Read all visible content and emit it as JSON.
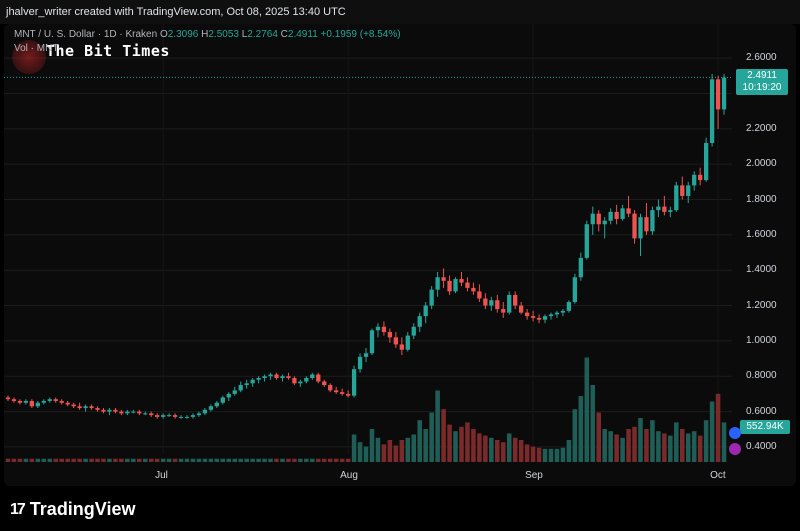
{
  "header": {
    "attribution": "jhalver_writer created with TradingView.com, Oct 08, 2025 13:40 UTC"
  },
  "legend": {
    "symbol": "MNT / U. S. Dollar · 1D · Kraken",
    "o_label": "O",
    "o_value": "2.3096",
    "h_label": "H",
    "h_value": "2.5053",
    "l_label": "L",
    "l_value": "2.2764",
    "c_label": "C",
    "c_value": "2.4911",
    "change": "+0.1959 (+8.54%)",
    "vol_label": "Vol · MNT"
  },
  "watermark": {
    "text": "The Bit Times"
  },
  "price_tag": {
    "price": "2.4911",
    "countdown": "10:19:20"
  },
  "volume_tag": {
    "value": "552.94K"
  },
  "footer": {
    "brand": "TradingView"
  },
  "colors": {
    "up": "#26a69a",
    "down": "#ef5350",
    "vol_up": "#1f5e57",
    "vol_down": "#7a2a2a",
    "background": "#0b0b0b"
  },
  "chart_data": {
    "type": "candlestick",
    "y_axis": {
      "ticks": [
        "2.6000",
        "2.4000",
        "2.2000",
        "2.0000",
        "1.8000",
        "1.6000",
        "1.4000",
        "1.2000",
        "1.0000",
        "0.8000",
        "0.6000",
        "0.4000"
      ],
      "ylim": [
        0.36,
        2.68
      ]
    },
    "x_axis": {
      "ticks": [
        "Jul",
        "Aug",
        "Sep",
        "Oct"
      ]
    },
    "last_price": 2.4911,
    "candles": [
      {
        "o": 0.68,
        "h": 0.69,
        "l": 0.66,
        "c": 0.67,
        "v": 0.03
      },
      {
        "o": 0.67,
        "h": 0.68,
        "l": 0.65,
        "c": 0.66,
        "v": 0.03
      },
      {
        "o": 0.66,
        "h": 0.67,
        "l": 0.64,
        "c": 0.65,
        "v": 0.03
      },
      {
        "o": 0.65,
        "h": 0.67,
        "l": 0.64,
        "c": 0.66,
        "v": 0.03
      },
      {
        "o": 0.66,
        "h": 0.67,
        "l": 0.62,
        "c": 0.63,
        "v": 0.03
      },
      {
        "o": 0.63,
        "h": 0.66,
        "l": 0.62,
        "c": 0.65,
        "v": 0.03
      },
      {
        "o": 0.65,
        "h": 0.67,
        "l": 0.64,
        "c": 0.66,
        "v": 0.03
      },
      {
        "o": 0.66,
        "h": 0.68,
        "l": 0.65,
        "c": 0.67,
        "v": 0.03
      },
      {
        "o": 0.67,
        "h": 0.68,
        "l": 0.65,
        "c": 0.66,
        "v": 0.03
      },
      {
        "o": 0.66,
        "h": 0.67,
        "l": 0.64,
        "c": 0.65,
        "v": 0.03
      },
      {
        "o": 0.65,
        "h": 0.66,
        "l": 0.63,
        "c": 0.64,
        "v": 0.03
      },
      {
        "o": 0.64,
        "h": 0.65,
        "l": 0.62,
        "c": 0.63,
        "v": 0.03
      },
      {
        "o": 0.63,
        "h": 0.65,
        "l": 0.61,
        "c": 0.62,
        "v": 0.03
      },
      {
        "o": 0.62,
        "h": 0.64,
        "l": 0.6,
        "c": 0.63,
        "v": 0.03
      },
      {
        "o": 0.63,
        "h": 0.64,
        "l": 0.61,
        "c": 0.62,
        "v": 0.03
      },
      {
        "o": 0.62,
        "h": 0.63,
        "l": 0.6,
        "c": 0.61,
        "v": 0.03
      },
      {
        "o": 0.61,
        "h": 0.62,
        "l": 0.59,
        "c": 0.6,
        "v": 0.03
      },
      {
        "o": 0.6,
        "h": 0.62,
        "l": 0.58,
        "c": 0.61,
        "v": 0.03
      },
      {
        "o": 0.61,
        "h": 0.62,
        "l": 0.59,
        "c": 0.6,
        "v": 0.03
      },
      {
        "o": 0.6,
        "h": 0.61,
        "l": 0.58,
        "c": 0.59,
        "v": 0.03
      },
      {
        "o": 0.59,
        "h": 0.61,
        "l": 0.58,
        "c": 0.6,
        "v": 0.03
      },
      {
        "o": 0.6,
        "h": 0.61,
        "l": 0.59,
        "c": 0.6,
        "v": 0.03
      },
      {
        "o": 0.6,
        "h": 0.61,
        "l": 0.58,
        "c": 0.59,
        "v": 0.03
      },
      {
        "o": 0.59,
        "h": 0.6,
        "l": 0.58,
        "c": 0.59,
        "v": 0.03
      },
      {
        "o": 0.59,
        "h": 0.6,
        "l": 0.57,
        "c": 0.58,
        "v": 0.03
      },
      {
        "o": 0.58,
        "h": 0.59,
        "l": 0.56,
        "c": 0.57,
        "v": 0.03
      },
      {
        "o": 0.57,
        "h": 0.59,
        "l": 0.56,
        "c": 0.58,
        "v": 0.03
      },
      {
        "o": 0.58,
        "h": 0.59,
        "l": 0.57,
        "c": 0.58,
        "v": 0.03
      },
      {
        "o": 0.58,
        "h": 0.59,
        "l": 0.56,
        "c": 0.57,
        "v": 0.03
      },
      {
        "o": 0.57,
        "h": 0.58,
        "l": 0.56,
        "c": 0.57,
        "v": 0.03
      },
      {
        "o": 0.57,
        "h": 0.58,
        "l": 0.56,
        "c": 0.57,
        "v": 0.03
      },
      {
        "o": 0.57,
        "h": 0.59,
        "l": 0.56,
        "c": 0.58,
        "v": 0.03
      },
      {
        "o": 0.58,
        "h": 0.6,
        "l": 0.57,
        "c": 0.59,
        "v": 0.03
      },
      {
        "o": 0.59,
        "h": 0.62,
        "l": 0.58,
        "c": 0.61,
        "v": 0.03
      },
      {
        "o": 0.61,
        "h": 0.64,
        "l": 0.6,
        "c": 0.63,
        "v": 0.03
      },
      {
        "o": 0.63,
        "h": 0.66,
        "l": 0.62,
        "c": 0.65,
        "v": 0.03
      },
      {
        "o": 0.65,
        "h": 0.69,
        "l": 0.64,
        "c": 0.68,
        "v": 0.03
      },
      {
        "o": 0.68,
        "h": 0.71,
        "l": 0.66,
        "c": 0.7,
        "v": 0.03
      },
      {
        "o": 0.7,
        "h": 0.74,
        "l": 0.69,
        "c": 0.72,
        "v": 0.03
      },
      {
        "o": 0.72,
        "h": 0.77,
        "l": 0.71,
        "c": 0.75,
        "v": 0.03
      },
      {
        "o": 0.75,
        "h": 0.78,
        "l": 0.73,
        "c": 0.76,
        "v": 0.03
      },
      {
        "o": 0.76,
        "h": 0.79,
        "l": 0.74,
        "c": 0.78,
        "v": 0.03
      },
      {
        "o": 0.78,
        "h": 0.8,
        "l": 0.76,
        "c": 0.79,
        "v": 0.03
      },
      {
        "o": 0.79,
        "h": 0.81,
        "l": 0.77,
        "c": 0.8,
        "v": 0.03
      },
      {
        "o": 0.8,
        "h": 0.82,
        "l": 0.78,
        "c": 0.81,
        "v": 0.03
      },
      {
        "o": 0.81,
        "h": 0.82,
        "l": 0.78,
        "c": 0.79,
        "v": 0.03
      },
      {
        "o": 0.79,
        "h": 0.81,
        "l": 0.77,
        "c": 0.8,
        "v": 0.03
      },
      {
        "o": 0.8,
        "h": 0.82,
        "l": 0.78,
        "c": 0.79,
        "v": 0.03
      },
      {
        "o": 0.79,
        "h": 0.8,
        "l": 0.75,
        "c": 0.76,
        "v": 0.03
      },
      {
        "o": 0.76,
        "h": 0.78,
        "l": 0.74,
        "c": 0.77,
        "v": 0.03
      },
      {
        "o": 0.77,
        "h": 0.8,
        "l": 0.76,
        "c": 0.79,
        "v": 0.03
      },
      {
        "o": 0.79,
        "h": 0.82,
        "l": 0.78,
        "c": 0.81,
        "v": 0.03
      },
      {
        "o": 0.81,
        "h": 0.82,
        "l": 0.76,
        "c": 0.77,
        "v": 0.03
      },
      {
        "o": 0.77,
        "h": 0.78,
        "l": 0.74,
        "c": 0.75,
        "v": 0.03
      },
      {
        "o": 0.75,
        "h": 0.76,
        "l": 0.71,
        "c": 0.72,
        "v": 0.03
      },
      {
        "o": 0.72,
        "h": 0.74,
        "l": 0.7,
        "c": 0.71,
        "v": 0.03
      },
      {
        "o": 0.71,
        "h": 0.73,
        "l": 0.69,
        "c": 0.7,
        "v": 0.03
      },
      {
        "o": 0.7,
        "h": 0.72,
        "l": 0.68,
        "c": 0.69,
        "v": 0.03
      },
      {
        "o": 0.69,
        "h": 0.86,
        "l": 0.68,
        "c": 0.84,
        "v": 0.25
      },
      {
        "o": 0.84,
        "h": 0.93,
        "l": 0.82,
        "c": 0.91,
        "v": 0.18
      },
      {
        "o": 0.91,
        "h": 0.96,
        "l": 0.88,
        "c": 0.93,
        "v": 0.14
      },
      {
        "o": 0.93,
        "h": 1.07,
        "l": 0.92,
        "c": 1.06,
        "v": 0.3
      },
      {
        "o": 1.06,
        "h": 1.1,
        "l": 1.02,
        "c": 1.08,
        "v": 0.22
      },
      {
        "o": 1.08,
        "h": 1.11,
        "l": 1.03,
        "c": 1.05,
        "v": 0.16
      },
      {
        "o": 1.05,
        "h": 1.07,
        "l": 0.99,
        "c": 1.02,
        "v": 0.2
      },
      {
        "o": 1.02,
        "h": 1.05,
        "l": 0.96,
        "c": 0.98,
        "v": 0.15
      },
      {
        "o": 0.98,
        "h": 1.02,
        "l": 0.92,
        "c": 0.95,
        "v": 0.2
      },
      {
        "o": 0.95,
        "h": 1.05,
        "l": 0.94,
        "c": 1.03,
        "v": 0.22
      },
      {
        "o": 1.03,
        "h": 1.1,
        "l": 1.01,
        "c": 1.08,
        "v": 0.25
      },
      {
        "o": 1.08,
        "h": 1.16,
        "l": 1.05,
        "c": 1.14,
        "v": 0.38
      },
      {
        "o": 1.14,
        "h": 1.22,
        "l": 1.1,
        "c": 1.2,
        "v": 0.3
      },
      {
        "o": 1.2,
        "h": 1.31,
        "l": 1.18,
        "c": 1.29,
        "v": 0.45
      },
      {
        "o": 1.29,
        "h": 1.39,
        "l": 1.25,
        "c": 1.36,
        "v": 0.65
      },
      {
        "o": 1.36,
        "h": 1.41,
        "l": 1.3,
        "c": 1.34,
        "v": 0.48
      },
      {
        "o": 1.34,
        "h": 1.37,
        "l": 1.26,
        "c": 1.28,
        "v": 0.34
      },
      {
        "o": 1.28,
        "h": 1.36,
        "l": 1.27,
        "c": 1.35,
        "v": 0.28
      },
      {
        "o": 1.35,
        "h": 1.39,
        "l": 1.31,
        "c": 1.33,
        "v": 0.32
      },
      {
        "o": 1.33,
        "h": 1.36,
        "l": 1.28,
        "c": 1.3,
        "v": 0.36
      },
      {
        "o": 1.3,
        "h": 1.33,
        "l": 1.26,
        "c": 1.28,
        "v": 0.3
      },
      {
        "o": 1.28,
        "h": 1.32,
        "l": 1.22,
        "c": 1.24,
        "v": 0.26
      },
      {
        "o": 1.24,
        "h": 1.27,
        "l": 1.18,
        "c": 1.2,
        "v": 0.24
      },
      {
        "o": 1.2,
        "h": 1.25,
        "l": 1.17,
        "c": 1.23,
        "v": 0.22
      },
      {
        "o": 1.23,
        "h": 1.26,
        "l": 1.16,
        "c": 1.18,
        "v": 0.2
      },
      {
        "o": 1.18,
        "h": 1.22,
        "l": 1.13,
        "c": 1.16,
        "v": 0.18
      },
      {
        "o": 1.16,
        "h": 1.28,
        "l": 1.15,
        "c": 1.26,
        "v": 0.26
      },
      {
        "o": 1.26,
        "h": 1.28,
        "l": 1.18,
        "c": 1.2,
        "v": 0.22
      },
      {
        "o": 1.2,
        "h": 1.22,
        "l": 1.15,
        "c": 1.16,
        "v": 0.2
      },
      {
        "o": 1.16,
        "h": 1.18,
        "l": 1.12,
        "c": 1.14,
        "v": 0.16
      },
      {
        "o": 1.14,
        "h": 1.17,
        "l": 1.11,
        "c": 1.13,
        "v": 0.14
      },
      {
        "o": 1.13,
        "h": 1.15,
        "l": 1.1,
        "c": 1.12,
        "v": 0.13
      },
      {
        "o": 1.12,
        "h": 1.15,
        "l": 1.1,
        "c": 1.14,
        "v": 0.12
      },
      {
        "o": 1.14,
        "h": 1.16,
        "l": 1.12,
        "c": 1.15,
        "v": 0.12
      },
      {
        "o": 1.15,
        "h": 1.17,
        "l": 1.13,
        "c": 1.16,
        "v": 0.12
      },
      {
        "o": 1.16,
        "h": 1.18,
        "l": 1.14,
        "c": 1.17,
        "v": 0.13
      },
      {
        "o": 1.17,
        "h": 1.23,
        "l": 1.16,
        "c": 1.22,
        "v": 0.2
      },
      {
        "o": 1.22,
        "h": 1.38,
        "l": 1.21,
        "c": 1.36,
        "v": 0.48
      },
      {
        "o": 1.36,
        "h": 1.5,
        "l": 1.34,
        "c": 1.47,
        "v": 0.6
      },
      {
        "o": 1.47,
        "h": 1.68,
        "l": 1.46,
        "c": 1.66,
        "v": 0.95
      },
      {
        "o": 1.66,
        "h": 1.76,
        "l": 1.6,
        "c": 1.72,
        "v": 0.7
      },
      {
        "o": 1.72,
        "h": 1.74,
        "l": 1.62,
        "c": 1.66,
        "v": 0.45
      },
      {
        "o": 1.66,
        "h": 1.7,
        "l": 1.58,
        "c": 1.68,
        "v": 0.3
      },
      {
        "o": 1.68,
        "h": 1.75,
        "l": 1.66,
        "c": 1.73,
        "v": 0.28
      },
      {
        "o": 1.73,
        "h": 1.77,
        "l": 1.66,
        "c": 1.69,
        "v": 0.25
      },
      {
        "o": 1.69,
        "h": 1.77,
        "l": 1.68,
        "c": 1.75,
        "v": 0.22
      },
      {
        "o": 1.75,
        "h": 1.82,
        "l": 1.7,
        "c": 1.72,
        "v": 0.3
      },
      {
        "o": 1.72,
        "h": 1.74,
        "l": 1.55,
        "c": 1.58,
        "v": 0.32
      },
      {
        "o": 1.58,
        "h": 1.72,
        "l": 1.48,
        "c": 1.7,
        "v": 0.4
      },
      {
        "o": 1.7,
        "h": 1.78,
        "l": 1.6,
        "c": 1.62,
        "v": 0.3
      },
      {
        "o": 1.62,
        "h": 1.76,
        "l": 1.6,
        "c": 1.74,
        "v": 0.38
      },
      {
        "o": 1.74,
        "h": 1.8,
        "l": 1.7,
        "c": 1.76,
        "v": 0.28
      },
      {
        "o": 1.76,
        "h": 1.82,
        "l": 1.71,
        "c": 1.73,
        "v": 0.26
      },
      {
        "o": 1.73,
        "h": 1.76,
        "l": 1.7,
        "c": 1.74,
        "v": 0.24
      },
      {
        "o": 1.74,
        "h": 1.9,
        "l": 1.73,
        "c": 1.88,
        "v": 0.36
      },
      {
        "o": 1.88,
        "h": 1.93,
        "l": 1.8,
        "c": 1.82,
        "v": 0.3
      },
      {
        "o": 1.82,
        "h": 1.9,
        "l": 1.78,
        "c": 1.88,
        "v": 0.26
      },
      {
        "o": 1.88,
        "h": 1.96,
        "l": 1.85,
        "c": 1.94,
        "v": 0.28
      },
      {
        "o": 1.94,
        "h": 1.98,
        "l": 1.88,
        "c": 1.91,
        "v": 0.24
      },
      {
        "o": 1.91,
        "h": 2.15,
        "l": 1.9,
        "c": 2.12,
        "v": 0.38
      },
      {
        "o": 2.12,
        "h": 2.51,
        "l": 2.1,
        "c": 2.48,
        "v": 0.55
      },
      {
        "o": 2.48,
        "h": 2.5,
        "l": 2.2,
        "c": 2.31,
        "v": 0.62
      },
      {
        "o": 2.31,
        "h": 2.51,
        "l": 2.28,
        "c": 2.49,
        "v": 0.36
      }
    ]
  }
}
